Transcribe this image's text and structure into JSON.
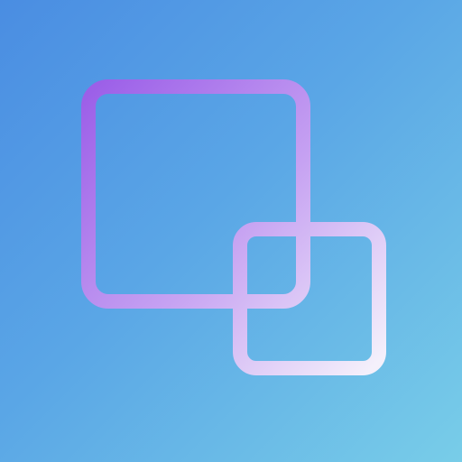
{
  "icon": {
    "name": "overlapping-squares-app-icon",
    "colors": {
      "background_start": "#4a8de2",
      "background_mid": "#5aa6e6",
      "background_end": "#78cde8",
      "shape_purple": "#9b5ee8",
      "shape_lavender": "#c6a2f2",
      "shape_white": "#f4f0fb"
    }
  }
}
